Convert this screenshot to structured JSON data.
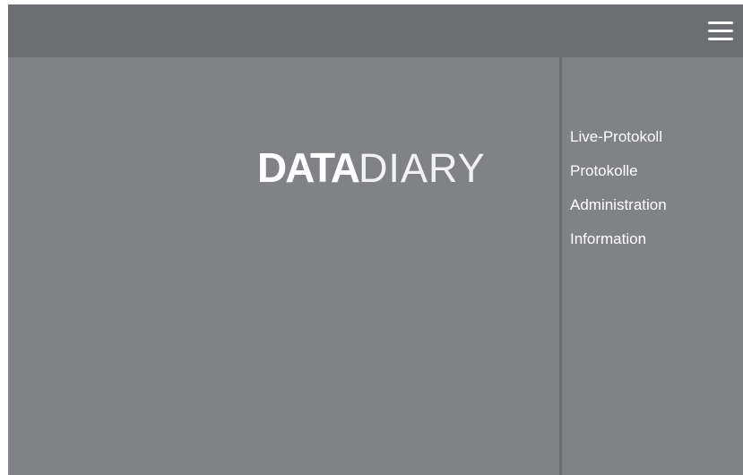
{
  "header": {
    "menu_icon": "hamburger-menu-icon"
  },
  "logo": {
    "part_bold": "DATA",
    "part_thin": "DIARY"
  },
  "side_menu": {
    "items": [
      {
        "label": "Live-Protokoll"
      },
      {
        "label": "Protokolle"
      },
      {
        "label": "Administration"
      },
      {
        "label": "Information"
      }
    ]
  },
  "colors": {
    "background": "#818285",
    "topbar": "#6d6e71",
    "text": "#ffffff"
  }
}
